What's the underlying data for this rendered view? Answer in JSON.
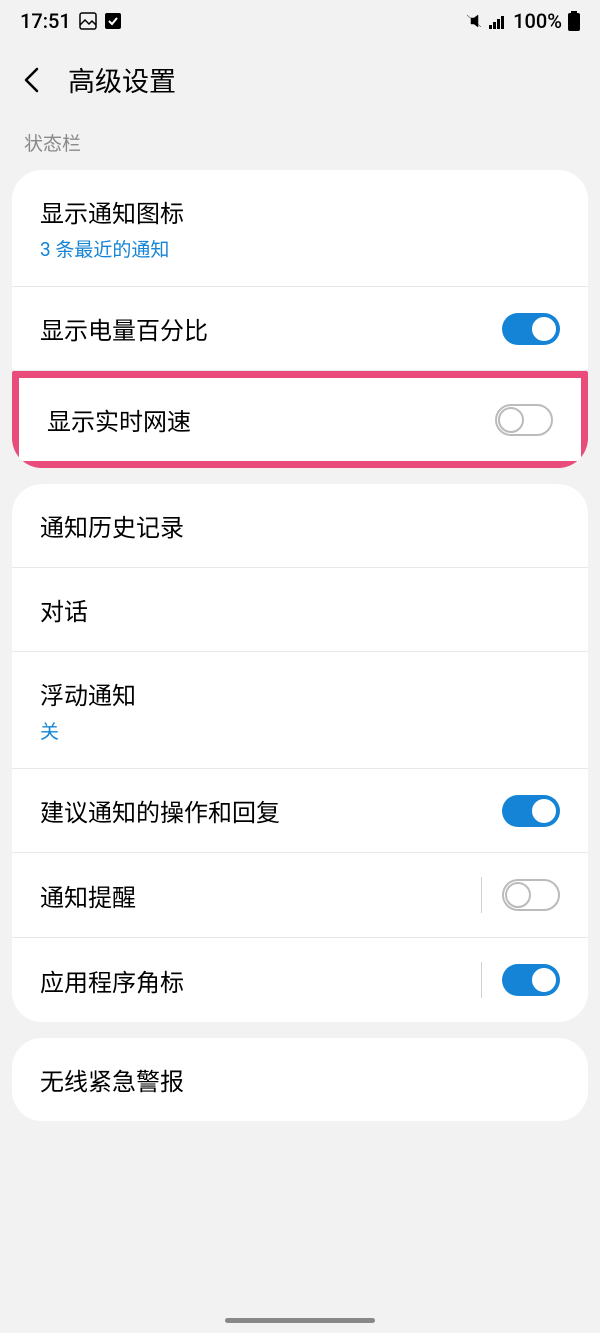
{
  "statusBar": {
    "time": "17:51",
    "battery": "100%"
  },
  "header": {
    "title": "高级设置"
  },
  "sectionLabel": "状态栏",
  "group1": {
    "item1": {
      "title": "显示通知图标",
      "subtitle": "3 条最近的通知"
    },
    "item2": {
      "title": "显示电量百分比"
    },
    "item3": {
      "title": "显示实时网速"
    }
  },
  "group2": {
    "item1": {
      "title": "通知历史记录"
    },
    "item2": {
      "title": "对话"
    },
    "item3": {
      "title": "浮动通知",
      "subtitle": "关"
    },
    "item4": {
      "title": "建议通知的操作和回复"
    },
    "item5": {
      "title": "通知提醒"
    },
    "item6": {
      "title": "应用程序角标"
    }
  },
  "group3": {
    "item1": {
      "title": "无线紧急警报"
    }
  }
}
